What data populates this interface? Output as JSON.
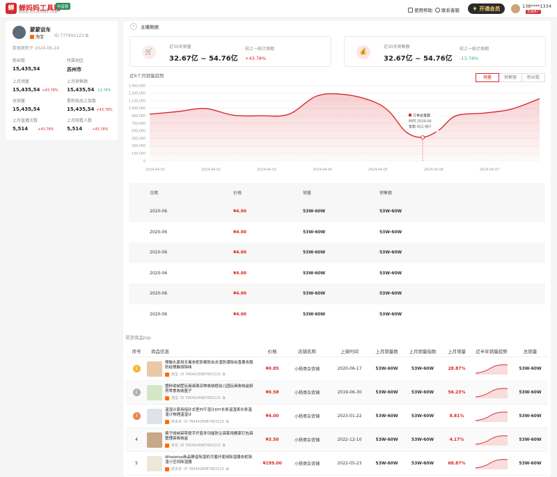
{
  "header": {
    "logo_text": "蝉妈妈工具箱",
    "logo_badge": "抖音版",
    "logo_sub": "WWW.51LAHAMA.COM",
    "help_label": "使用帮助",
    "service_label": "联系客服",
    "vip_label": "开通会员",
    "phone": "138****1334",
    "vip_tag": "普通用户"
  },
  "profile": {
    "name": "蒙蒙说车",
    "platform": "淘宝",
    "id": "ID 777993123",
    "update": "数据更新于 2024-06-24",
    "stats": [
      {
        "label": "粉丝数",
        "value": "15,435,54",
        "change": ""
      },
      {
        "label": "所属地区",
        "value": "苏州市",
        "change": ""
      },
      {
        "label": "上月销量",
        "value": "15,435,54",
        "change": "+43.78%"
      },
      {
        "label": "上月销售额",
        "value": "15,435,54",
        "change": "-13.78%"
      },
      {
        "label": "总销量",
        "value": "15,435,54",
        "change": ""
      },
      {
        "label": "累积商品上架数",
        "value": "15,435,54",
        "change": "+43.78%"
      },
      {
        "label": "上月直播次数",
        "value": "5,514",
        "change": "+43.78%"
      },
      {
        "label": "上月观看人数",
        "value": "5,514",
        "change": "+43.78%"
      }
    ]
  },
  "main": {
    "crumb": "主播数据",
    "card1": {
      "label": "近30天销量",
      "value": "32.67亿 ~ 54.76亿",
      "compare_label": "较上一统计周期",
      "change": "+43.78%"
    },
    "card2": {
      "label": "近30天销售额",
      "value": "32.67亿 ~ 54.76亿",
      "compare_label": "较上一统计周期",
      "change": "-13.78%"
    },
    "trend_title": "近6个月销量趋势",
    "tabs": [
      "销量",
      "销售额",
      "粉丝数"
    ],
    "tooltip": {
      "title": "订单总金额",
      "time": "时间 2024-04",
      "amount": "金额 452,987"
    }
  },
  "chart_data": {
    "type": "area",
    "y_ticks": [
      "1,450,000",
      "1,300,000",
      "1,150,000",
      "1,000,000",
      "900,000",
      "750,000",
      "600,000",
      "450,000",
      "300,000",
      "150,000",
      "0"
    ],
    "x_ticks": [
      "2024-04-01",
      "2024-04-02",
      "2024-04-03",
      "2024-04-04",
      "2024-04-05",
      "2024-04-06",
      "2024-04-07"
    ],
    "ylim": [
      0,
      1450000
    ],
    "x": [
      0,
      0.5,
      1,
      1.5,
      2,
      2.5,
      3,
      3.5,
      4,
      4.3,
      4.6,
      4.9,
      5.2,
      5.5,
      6,
      6.5,
      7
    ],
    "values": [
      900000,
      950000,
      1010000,
      880000,
      870000,
      900000,
      1250000,
      1280000,
      1150000,
      950000,
      560000,
      452987,
      600000,
      870000,
      920000,
      1000000,
      1200000
    ],
    "series_color": "#d8262d",
    "grid": true
  },
  "table1": {
    "headers": [
      "日期",
      "价格",
      "销量",
      "销售额"
    ],
    "rows": [
      [
        "2020-06",
        "¥4.00",
        "53W-60W",
        "53W-60W"
      ],
      [
        "2020-06",
        "¥4.00",
        "53W-60W",
        "53W-60W"
      ],
      [
        "2020-06",
        "¥4.00",
        "53W-60W",
        "53W-60W"
      ],
      [
        "2020-06",
        "¥4.00",
        "53W-60W",
        "53W-60W"
      ],
      [
        "2020-06",
        "¥4.00",
        "53W-60W",
        "53W-60W"
      ],
      [
        "2020-06",
        "¥4.00",
        "53W-60W",
        "53W-60W"
      ]
    ]
  },
  "products": {
    "title": "带货商品top",
    "headers": [
      "序号",
      "商品信息",
      "价格",
      "店铺名称",
      "上架时间",
      "上月销量数",
      "上月销量指数",
      "上月增量",
      "近半年销量趋势",
      "总销量"
    ],
    "rows": [
      {
        "idx": "1",
        "badge_color": "#f7b733",
        "thumb_color": "#e8c9a8",
        "title": "樟脑丸家用无毒衣柜防霉防虫去湿防潮除虫香薰衣服防蛀樟脑球除味",
        "platform": "淘宝",
        "pid": "ID 7664428987663123",
        "price": "¥0.85",
        "shop": "小杨哥杂货铺",
        "date": "2020-06-17",
        "s1": "53W-60W",
        "s2": "53W-60W",
        "inc": "28.87%",
        "total": "53W-60W"
      },
      {
        "idx": "2",
        "badge_color": "#b0b0b0",
        "thumb_color": "#d4e6c8",
        "title": "塑料收纳筐玩具桌面杂物收纳框幼儿园玩具收纳盒厨房零食收纳篮子",
        "platform": "淘宝",
        "pid": "ID 7664428987663123",
        "price": "¥0.58",
        "shop": "小杨哥杂货铺",
        "date": "2019-06-30",
        "s1": "53W-60W",
        "s2": "53W-60W",
        "inc": "56.23%",
        "total": "53W-60W"
      },
      {
        "idx": "3",
        "badge_color": "#e8814e",
        "thumb_color": "#dfe3e8",
        "title": "温湿计家用指针式室内干湿计DIY长条温湿表长条温湿计物理温湿计",
        "platform": "拼多多",
        "pid": "ID 7664428987663123",
        "price": "¥4.00",
        "shop": "小杨哥杂货铺",
        "date": "2023-01-22",
        "s1": "53W-60W",
        "s2": "53W-60W",
        "inc": "8.81%",
        "total": "53W-60W"
      },
      {
        "idx": "4",
        "badge_color": "",
        "thumb_color": "#c7a889",
        "title": "裤子收纳袋带提手开窗多功能防尘袋家用搬家打包袋整理袋收纳盒",
        "platform": "京东",
        "pid": "ID 7664428987663123",
        "price": "¥3.50",
        "shop": "小杨哥杂货铺",
        "date": "2022-12-10",
        "s1": "53W-60W",
        "s2": "53W-60W",
        "inc": "4.17%",
        "total": "53W-60W"
      },
      {
        "idx": "5",
        "badge_color": "",
        "thumb_color": "#efe6da",
        "title": "Whaletoo新品静音除湿机可循环使用除湿器衣柜除湿小空间除湿器",
        "platform": "拼多多",
        "pid": "ID 7664428987663123",
        "price": "¥199.00",
        "shop": "小杨哥杂货铺",
        "date": "2022-05-23",
        "s1": "53W-60W",
        "s2": "53W-60W",
        "inc": "68.87%",
        "total": "53W-60W"
      }
    ]
  }
}
